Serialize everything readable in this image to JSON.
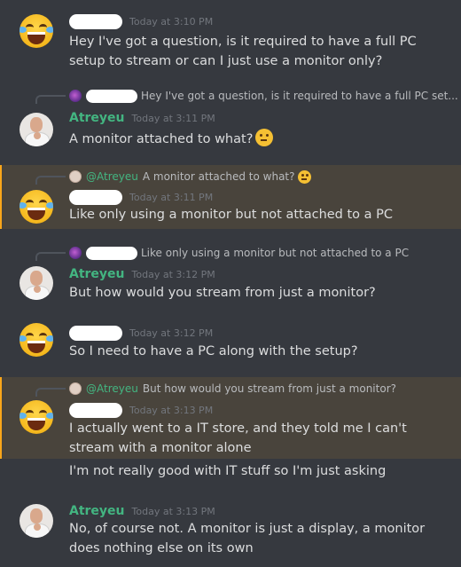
{
  "messages": [
    {
      "author": "",
      "timestamp": "Today at 3:10 PM",
      "text": "Hey I've got a question, is it required to have a full PC setup to stream or can I just use a monitor only?"
    },
    {
      "reply_preview": "Hey I've got a question, is it required to have a full PC set...",
      "author": "Atreyeu",
      "timestamp": "Today at 3:11 PM",
      "text": "A monitor attached to what?"
    },
    {
      "reply_author": "@Atreyeu",
      "reply_preview": "A monitor attached to what?",
      "author": "",
      "timestamp": "Today at 3:11 PM",
      "text": "Like only using a monitor but not attached to a PC"
    },
    {
      "reply_preview": "Like only using a monitor but not attached to a PC",
      "author": "Atreyeu",
      "timestamp": "Today at 3:12 PM",
      "text": "But how would you stream from just a monitor?"
    },
    {
      "author": "",
      "timestamp": "Today at 3:12 PM",
      "text": "So I need to have a PC along with the setup?"
    },
    {
      "reply_author": "@Atreyeu",
      "reply_preview": "But how would you stream from just a monitor?",
      "author": "",
      "timestamp": "Today at 3:13 PM",
      "text": "I actually went to a IT store, and they told me I can't stream with a monitor alone",
      "followup": "I'm not really good with IT stuff so I'm just asking"
    },
    {
      "author": "Atreyeu",
      "timestamp": "Today at 3:13 PM",
      "text": "No, of course not. A monitor is just a display, a monitor does nothing else on its own"
    }
  ],
  "colors": {
    "background": "#36393f",
    "mention_highlight": "#49443c",
    "mention_bar": "#faa61a",
    "username": "#43b581",
    "timestamp": "#72767d"
  },
  "icons": {
    "laughing_avatar": "face-with-tears-of-joy",
    "thinking_emoji": "thinking-face"
  }
}
